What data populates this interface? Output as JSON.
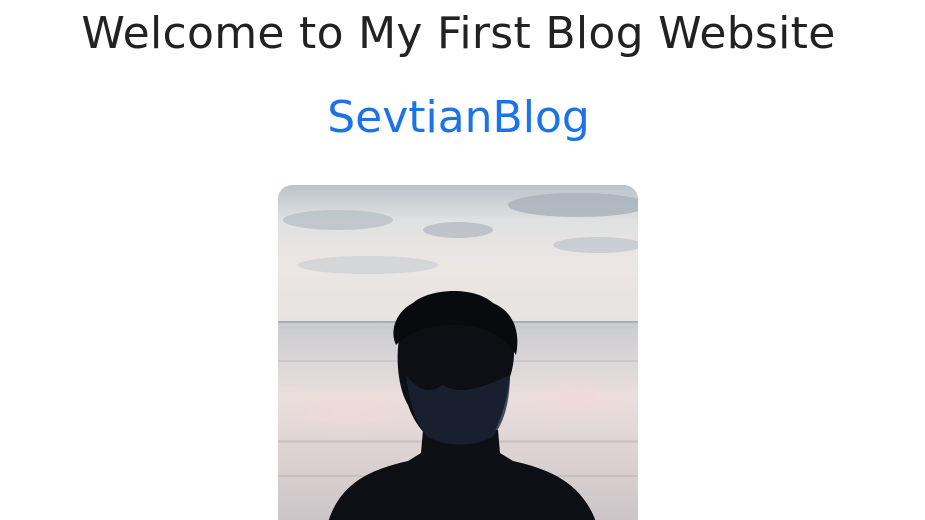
{
  "header": {
    "welcome_text": "Welcome to My First Blog Website",
    "brand_name": "SevtianBlog"
  },
  "profile": {
    "image_subject": "silhouette-person-beach-icon"
  },
  "colors": {
    "accent": "#1a73e8",
    "text": "#222222",
    "background": "#ffffff"
  }
}
